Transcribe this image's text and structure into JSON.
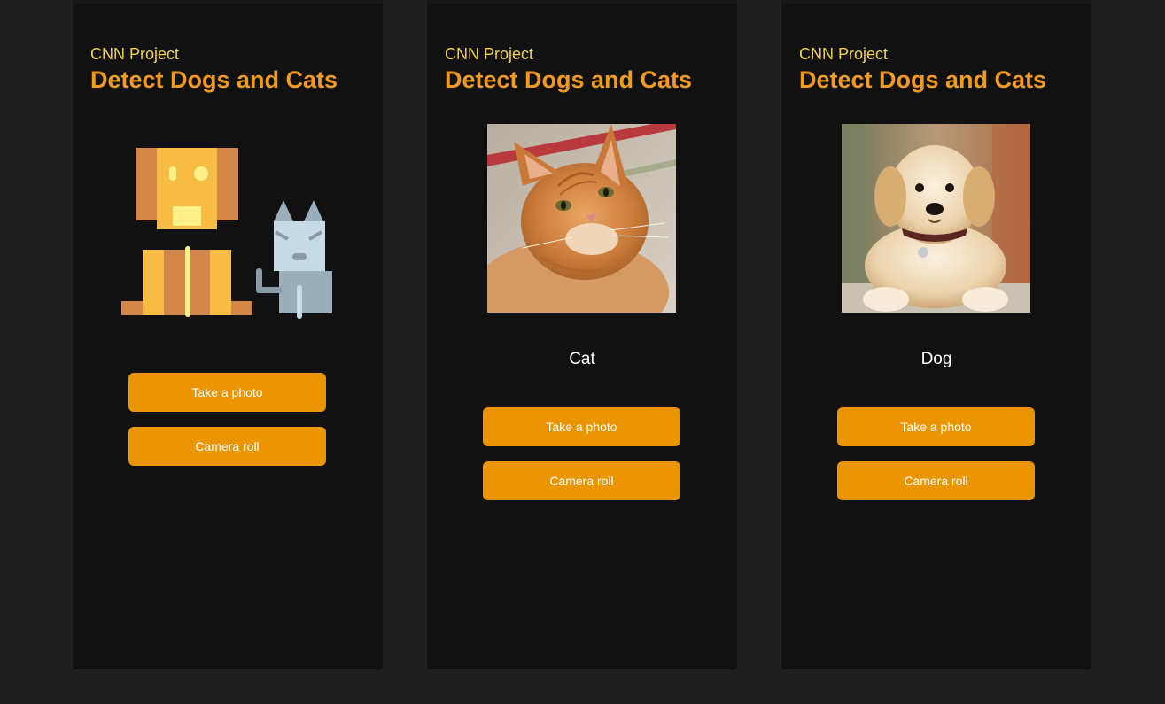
{
  "screens": [
    {
      "subtitle": "CNN Project",
      "title": "Detect Dogs and Cats",
      "image": "dog-and-cat-illustration",
      "result": "",
      "take_photo_label": "Take a photo",
      "camera_roll_label": "Camera roll"
    },
    {
      "subtitle": "CNN Project",
      "title": "Detect Dogs and Cats",
      "image": "cat-photo",
      "result": "Cat",
      "take_photo_label": "Take a photo",
      "camera_roll_label": "Camera roll"
    },
    {
      "subtitle": "CNN Project",
      "title": "Detect Dogs and Cats",
      "image": "dog-photo",
      "result": "Dog",
      "take_photo_label": "Take a photo",
      "camera_roll_label": "Camera roll"
    }
  ],
  "colors": {
    "page_background": "#1f1f1f",
    "screen_background": "#111111",
    "subtitle": "#f2d24a",
    "title": "#f09a22",
    "button": "#ea9500",
    "button_text": "#ffffff",
    "result_text": "#ffffff"
  }
}
